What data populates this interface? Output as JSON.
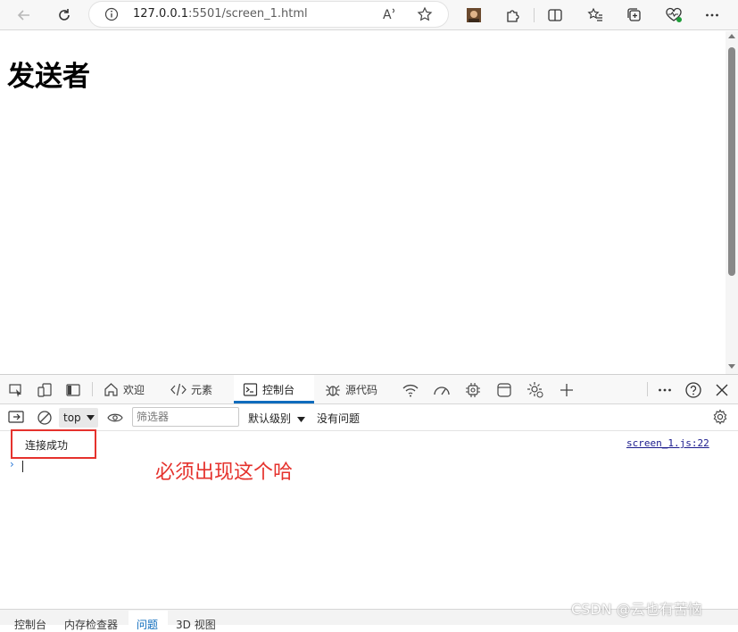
{
  "browser": {
    "url_host": "127.0.0.1",
    "url_rest": ":5501/screen_1.html"
  },
  "page": {
    "title": "发送者"
  },
  "devtools": {
    "tabs": [
      {
        "label": "欢迎"
      },
      {
        "label": "元素"
      },
      {
        "label": "控制台"
      },
      {
        "label": "源代码"
      }
    ],
    "console": {
      "context": "top",
      "filter_placeholder": "筛选器",
      "level": "默认级别",
      "issues": "没有问题",
      "log_message": "连接成功",
      "log_source": "screen_1.js:22",
      "prompt_symbol": "›"
    },
    "drawer_tabs": [
      {
        "label": "控制台"
      },
      {
        "label": "内存检查器"
      },
      {
        "label": "问题"
      },
      {
        "label": "3D 视图"
      }
    ]
  },
  "annotation": {
    "text": "必须出现这个哈",
    "color": "#e5322d"
  },
  "watermark": "CSDN @云也有苦恼",
  "colors": {
    "accent": "#0f6cbd",
    "annotation_red": "#e5322d"
  }
}
